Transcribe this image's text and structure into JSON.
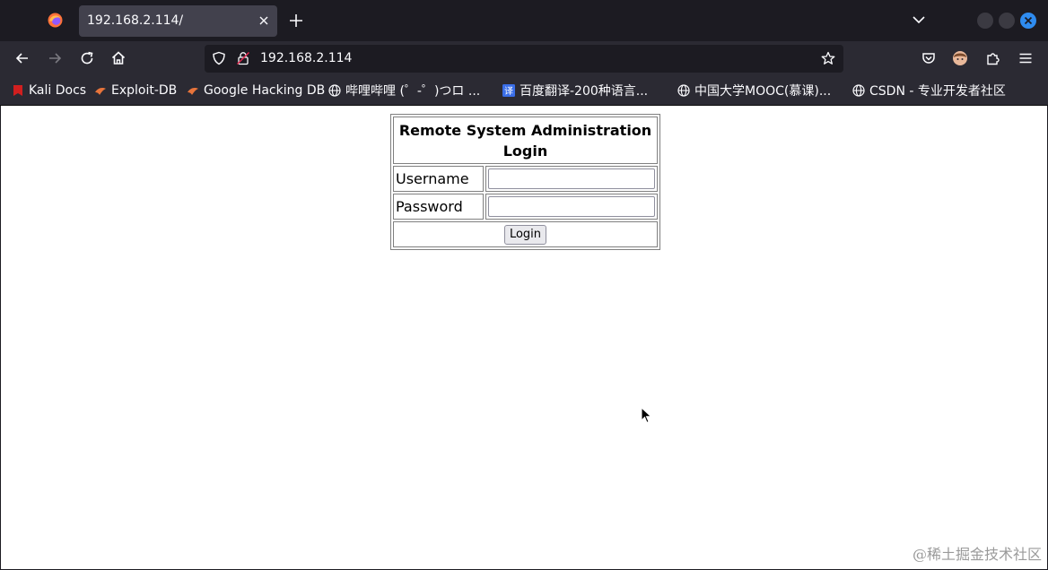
{
  "browser": {
    "tab_title": "192.168.2.114/",
    "url": "192.168.2.114"
  },
  "bookmarks": [
    {
      "label": "Kali Docs",
      "icon": "kali-docs-icon",
      "color": "#d11f1f"
    },
    {
      "label": "Exploit-DB",
      "icon": "exploit-db-icon",
      "color": "#e8743b"
    },
    {
      "label": "Google Hacking DB",
      "icon": "ghdb-icon",
      "color": "#e8743b"
    },
    {
      "label": "哔哩哔哩 (゜-゜)つロ ...",
      "icon": "globe-icon",
      "color": "#fbfbfe"
    },
    {
      "label": "百度翻译-200种语言...",
      "icon": "translate-icon",
      "color": "#3a6ee8"
    },
    {
      "label": "中国大学MOOC(慕课)...",
      "icon": "globe-icon",
      "color": "#fbfbfe"
    },
    {
      "label": "CSDN - 专业开发者社区",
      "icon": "globe-icon",
      "color": "#fbfbfe"
    }
  ],
  "login": {
    "title": "Remote System Administration Login",
    "username_label": "Username",
    "password_label": "Password",
    "username_value": "",
    "password_value": "",
    "button_label": "Login"
  },
  "watermark": "@稀土掘金技术社区"
}
